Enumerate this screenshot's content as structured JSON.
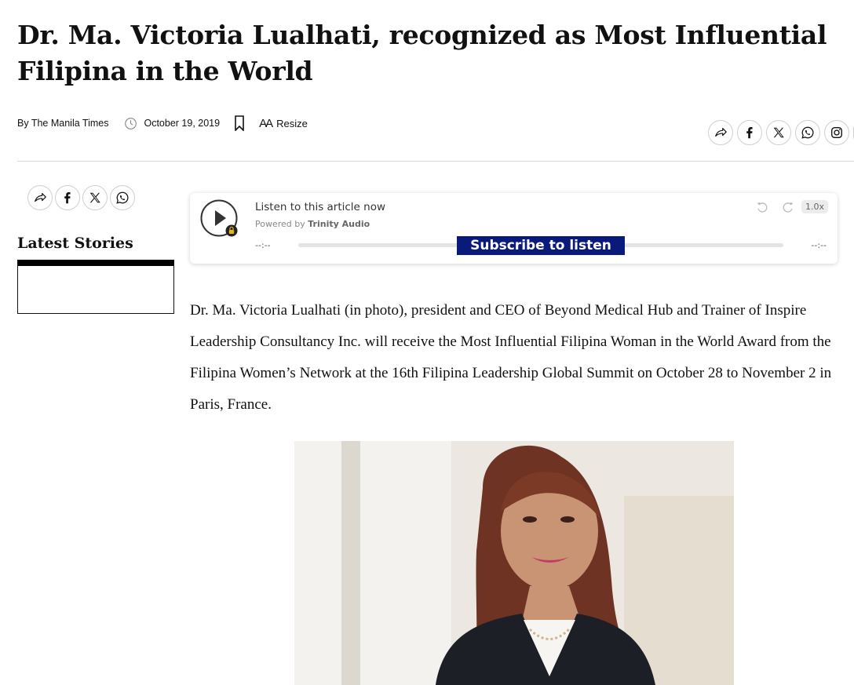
{
  "article": {
    "headline": "Dr. Ma. Victoria Lualhati, recognized as Most Influential Filipina in the World",
    "byline": "By The Manila Times",
    "date": "October 19, 2019",
    "resize_label": "Resize",
    "resize_icon_text": "AA",
    "body": "Dr. Ma. Victoria Lualhati (in photo), president and CEO of Beyond Medical Hub and Trainer of Inspire Leadership Consultancy Inc. will receive the Most Influential Filipina Woman in the World Award from the Filipina Women’s Network at the 16th Filipina Leadership Global Summit on October 28 to November 2 in Paris, France."
  },
  "share_top": {
    "icons": [
      "share-icon",
      "facebook-icon",
      "x-icon",
      "whatsapp-icon",
      "instagram-icon"
    ]
  },
  "share_side": {
    "icons": [
      "share-icon",
      "facebook-icon",
      "x-icon",
      "whatsapp-icon"
    ]
  },
  "sidebar": {
    "latest_title": "Latest Stories"
  },
  "audio_player": {
    "listen_label": "Listen to this article now",
    "powered_prefix": "Powered by",
    "powered_brand": "Trinity Audio",
    "time_elapsed": "--:--",
    "time_total": "--:--",
    "subscribe_label": "Subscribe to listen",
    "speed": "1.0x",
    "progress": 0
  },
  "colors": {
    "subscribe_bg": "#0a1a7a",
    "lock_badge": "#e3b51b",
    "divider": "#d8d8d8"
  }
}
